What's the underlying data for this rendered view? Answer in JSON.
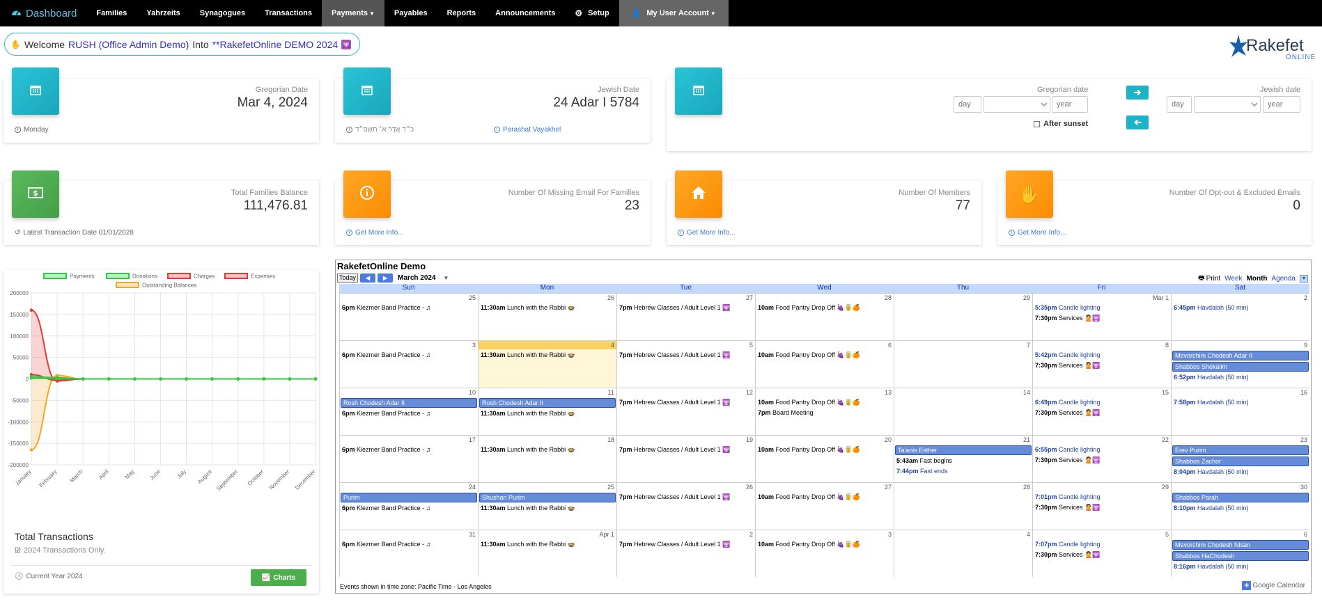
{
  "nav": {
    "brand": "Dashboard",
    "items": [
      "Families",
      "Yahrzeits",
      "Synagogues",
      "Transactions",
      "Payments",
      "Payables",
      "Reports",
      "Announcements",
      "Setup",
      "My User Account"
    ]
  },
  "welcome": {
    "prefix": "Welcome",
    "user": "RUSH (Office Admin Demo)",
    "mid": "Into",
    "org": "**RakefetOnline DEMO 2024"
  },
  "logo": {
    "name": "Rakefet",
    "sub": "ONLINE"
  },
  "greg": {
    "label": "Gregorian Date",
    "value": "Mar 4, 2024",
    "foot": "Monday"
  },
  "jewish": {
    "label": "Jewish Date",
    "value": "24 Adar I 5784",
    "foot_heb": "כ״ד אֲדָר א׳ תשפ״ד",
    "foot_parasha": "Parashat Vayakhel"
  },
  "converter": {
    "greg_label": "Gregorian date",
    "jewish_label": "Jewish date",
    "day_ph": "day",
    "year_ph": "year",
    "after_sunset": "After sunset"
  },
  "stats": [
    {
      "label": "Total Families Balance",
      "value": "111,476.81",
      "foot": "Latest Transaction Date 01/01/2028"
    },
    {
      "label": "Number Of Missing Email For Families",
      "value": "23",
      "foot": "Get More Info..."
    },
    {
      "label": "Number Of Members",
      "value": "77",
      "foot": "Get More Info..."
    },
    {
      "label": "Number Of Opt-out & Excluded Emails",
      "value": "0",
      "foot": "Get More Info..."
    }
  ],
  "transactions": {
    "title": "Total Transactions",
    "check": "2024 Transactions Only.",
    "foot": "Current Year 2024",
    "button": "Charts"
  },
  "chart_data": {
    "type": "line",
    "categories": [
      "January",
      "February",
      "March",
      "April",
      "May",
      "June",
      "July",
      "August",
      "September",
      "October",
      "November",
      "December"
    ],
    "series": [
      {
        "name": "Payments",
        "color": "#2ecc40",
        "values": [
          5000,
          3000,
          0,
          0,
          0,
          0,
          0,
          0,
          0,
          0,
          0,
          0
        ]
      },
      {
        "name": "Donations",
        "color": "#2ecc40",
        "values": [
          2000,
          1000,
          0,
          0,
          0,
          0,
          0,
          0,
          0,
          0,
          0,
          0
        ]
      },
      {
        "name": "Charges",
        "color": "#e53935",
        "values": [
          160000,
          -5000,
          0,
          0,
          0,
          0,
          0,
          0,
          0,
          0,
          0,
          0
        ]
      },
      {
        "name": "Expenses",
        "color": "#e53935",
        "values": [
          10000,
          -3000,
          0,
          0,
          0,
          0,
          0,
          0,
          0,
          0,
          0,
          0
        ]
      },
      {
        "name": "Outstanding Balances",
        "color": "#f5a623",
        "values": [
          -165000,
          8000,
          0,
          0,
          0,
          0,
          0,
          0,
          0,
          0,
          0,
          0
        ]
      }
    ],
    "yticks": [
      "200000",
      "150000",
      "100000",
      "50000",
      "0",
      "-50000",
      "-100000",
      "-150000",
      "-200000"
    ],
    "ylim": [
      -200000,
      200000
    ]
  },
  "calendar": {
    "title": "RakefetOnline Demo",
    "today": "Today",
    "month": "March 2024",
    "print": "Print",
    "tabs": [
      "Week",
      "Month",
      "Agenda"
    ],
    "dow": [
      "Sun",
      "Mon",
      "Tue",
      "Wed",
      "Thu",
      "Fri",
      "Sat"
    ],
    "footer": "Events shown in time zone: Pacific Time - Los Angeles",
    "gcal": "Google Calendar",
    "weeks": [
      [
        {
          "d": "25",
          "ev": [
            [
              "6pm",
              "Klezmer Band Practice - ♫"
            ]
          ]
        },
        {
          "d": "26",
          "ev": [
            [
              "11:30am",
              "Lunch with the Rabbi 🍲"
            ]
          ]
        },
        {
          "d": "27",
          "ev": [
            [
              "7pm",
              "Hebrew Classes / Adult Level 1 🕎"
            ]
          ]
        },
        {
          "d": "28",
          "ev": [
            [
              "10am",
              "Food Pantry Drop Off 🍇🥫🍊"
            ]
          ]
        },
        {
          "d": "29",
          "ev": []
        },
        {
          "d": "Mar 1",
          "ev": [
            [
              "5:35pm",
              "Candle lighting",
              "b"
            ],
            [
              "7:30pm",
              "Services 🙎🕎"
            ]
          ]
        },
        {
          "d": "2",
          "ev": [
            [
              "6:45pm",
              "Havdalah (50 min)",
              "b"
            ]
          ]
        }
      ],
      [
        {
          "d": "3",
          "ev": [
            [
              "6pm",
              "Klezmer Band Practice - ♫"
            ]
          ]
        },
        {
          "d": "4",
          "today": true,
          "ev": [
            [
              "11:30am",
              "Lunch with the Rabbi 🍲"
            ]
          ]
        },
        {
          "d": "5",
          "ev": [
            [
              "7pm",
              "Hebrew Classes / Adult Level 1 🕎"
            ]
          ]
        },
        {
          "d": "6",
          "ev": [
            [
              "10am",
              "Food Pantry Drop Off 🍇🥫🍊"
            ]
          ]
        },
        {
          "d": "7",
          "ev": []
        },
        {
          "d": "8",
          "ev": [
            [
              "5:42pm",
              "Candle lighting",
              "b"
            ],
            [
              "7:30pm",
              "Services 🙎🕎"
            ]
          ]
        },
        {
          "d": "9",
          "all": [
            "Mevorchim Chodesh Adar II",
            "Shabbos Shekalim"
          ],
          "ev": [
            [
              "6:52pm",
              "Havdalah (50 min)",
              "b"
            ]
          ]
        }
      ],
      [
        {
          "d": "10",
          "all": [
            "Rosh Chodesh Adar II"
          ],
          "ev": [
            [
              "6pm",
              "Klezmer Band Practice - ♫"
            ]
          ]
        },
        {
          "d": "11",
          "all": [
            "Rosh Chodesh Adar II"
          ],
          "ev": [
            [
              "11:30am",
              "Lunch with the Rabbi 🍲"
            ]
          ]
        },
        {
          "d": "12",
          "ev": [
            [
              "7pm",
              "Hebrew Classes / Adult Level 1 🕎"
            ]
          ]
        },
        {
          "d": "13",
          "ev": [
            [
              "10am",
              "Food Pantry Drop Off 🍇🥫🍊"
            ],
            [
              "7pm",
              "Board Meeting"
            ]
          ]
        },
        {
          "d": "14",
          "ev": []
        },
        {
          "d": "15",
          "ev": [
            [
              "6:49pm",
              "Candle lighting",
              "b"
            ],
            [
              "7:30pm",
              "Services 🙎🕎"
            ]
          ]
        },
        {
          "d": "16",
          "ev": [
            [
              "7:58pm",
              "Havdalah (50 min)",
              "b"
            ]
          ]
        }
      ],
      [
        {
          "d": "17",
          "ev": [
            [
              "6pm",
              "Klezmer Band Practice - ♫"
            ]
          ]
        },
        {
          "d": "18",
          "ev": [
            [
              "11:30am",
              "Lunch with the Rabbi 🍲"
            ]
          ]
        },
        {
          "d": "19",
          "ev": [
            [
              "7pm",
              "Hebrew Classes / Adult Level 1 🕎"
            ]
          ]
        },
        {
          "d": "20",
          "ev": [
            [
              "10am",
              "Food Pantry Drop Off 🍇🥫🍊"
            ]
          ]
        },
        {
          "d": "21",
          "all": [
            "Ta'anis Esther"
          ],
          "ev": [
            [
              "5:43am",
              "Fast begins"
            ],
            [
              "7:44pm",
              "Fast ends",
              "b"
            ]
          ]
        },
        {
          "d": "22",
          "ev": [
            [
              "6:55pm",
              "Candle lighting",
              "b"
            ],
            [
              "7:30pm",
              "Services 🙎🕎"
            ]
          ]
        },
        {
          "d": "23",
          "all": [
            "Erev Purim",
            "Shabbos Zachor"
          ],
          "ev": [
            [
              "8:04pm",
              "Havdalah (50 min)",
              "b"
            ]
          ]
        }
      ],
      [
        {
          "d": "24",
          "all": [
            "Purim"
          ],
          "ev": [
            [
              "6pm",
              "Klezmer Band Practice - ♫"
            ]
          ]
        },
        {
          "d": "25",
          "all": [
            "Shushan Purim"
          ],
          "ev": [
            [
              "11:30am",
              "Lunch with the Rabbi 🍲"
            ]
          ]
        },
        {
          "d": "26",
          "ev": [
            [
              "7pm",
              "Hebrew Classes / Adult Level 1 🕎"
            ]
          ]
        },
        {
          "d": "27",
          "ev": [
            [
              "10am",
              "Food Pantry Drop Off 🍇🥫🍊"
            ]
          ]
        },
        {
          "d": "28",
          "ev": []
        },
        {
          "d": "29",
          "ev": [
            [
              "7:01pm",
              "Candle lighting",
              "b"
            ],
            [
              "7:30pm",
              "Services 🙎🕎"
            ]
          ]
        },
        {
          "d": "30",
          "all": [
            "Shabbos Parah"
          ],
          "ev": [
            [
              "8:10pm",
              "Havdalah (50 min)",
              "b"
            ]
          ]
        }
      ],
      [
        {
          "d": "31",
          "ev": [
            [
              "6pm",
              "Klezmer Band Practice - ♫"
            ]
          ]
        },
        {
          "d": "Apr 1",
          "ev": [
            [
              "11:30am",
              "Lunch with the Rabbi 🍲"
            ]
          ]
        },
        {
          "d": "2",
          "ev": [
            [
              "7pm",
              "Hebrew Classes / Adult Level 1 🕎"
            ]
          ]
        },
        {
          "d": "3",
          "ev": [
            [
              "10am",
              "Food Pantry Drop Off 🍇🥫🍊"
            ]
          ]
        },
        {
          "d": "4",
          "ev": []
        },
        {
          "d": "5",
          "ev": [
            [
              "7:07pm",
              "Candle lighting",
              "b"
            ],
            [
              "7:30pm",
              "Services 🙎🕎"
            ]
          ]
        },
        {
          "d": "6",
          "all": [
            "Mevorchim Chodesh Nisan",
            "Shabbos HaChodesh"
          ],
          "ev": [
            [
              "8:16pm",
              "Havdalah (50 min)",
              "b"
            ]
          ]
        }
      ]
    ]
  }
}
